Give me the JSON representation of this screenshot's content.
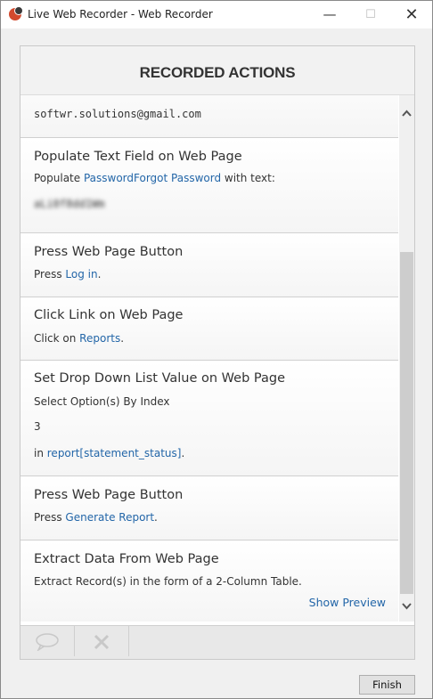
{
  "window": {
    "title": "Live Web Recorder - Web Recorder"
  },
  "panel": {
    "header": "RECORDED ACTIONS"
  },
  "actions": [
    {
      "lines": [
        "softwr.solutions@gmail.com"
      ]
    },
    {
      "title": "Populate Text Field on Web Page",
      "prefix": "Populate ",
      "link": "PasswordForgot Password",
      "suffix": " with text:",
      "masked_value": "aLi0f8dd1Wm"
    },
    {
      "title": "Press Web Page Button",
      "prefix": "Press ",
      "link": "Log in",
      "suffix": "."
    },
    {
      "title": "Click Link on Web Page",
      "prefix": "Click on ",
      "link": "Reports",
      "suffix": "."
    },
    {
      "title": "Set Drop Down List Value on Web Page",
      "option_label": "Select Option(s) By Index",
      "option_value": "3",
      "prefix": "in ",
      "link": "report[statement_status]",
      "suffix": "."
    },
    {
      "title": "Press Web Page Button",
      "prefix": "Press ",
      "link": "Generate Report",
      "suffix": "."
    },
    {
      "title": "Extract Data From Web Page",
      "desc": "Extract Record(s) in the form of a 2-Column Table.",
      "preview_label": "Show Preview"
    }
  ],
  "footer": {
    "finish_label": "Finish"
  },
  "icons": {
    "comment": "comment-icon",
    "delete": "delete-icon"
  }
}
